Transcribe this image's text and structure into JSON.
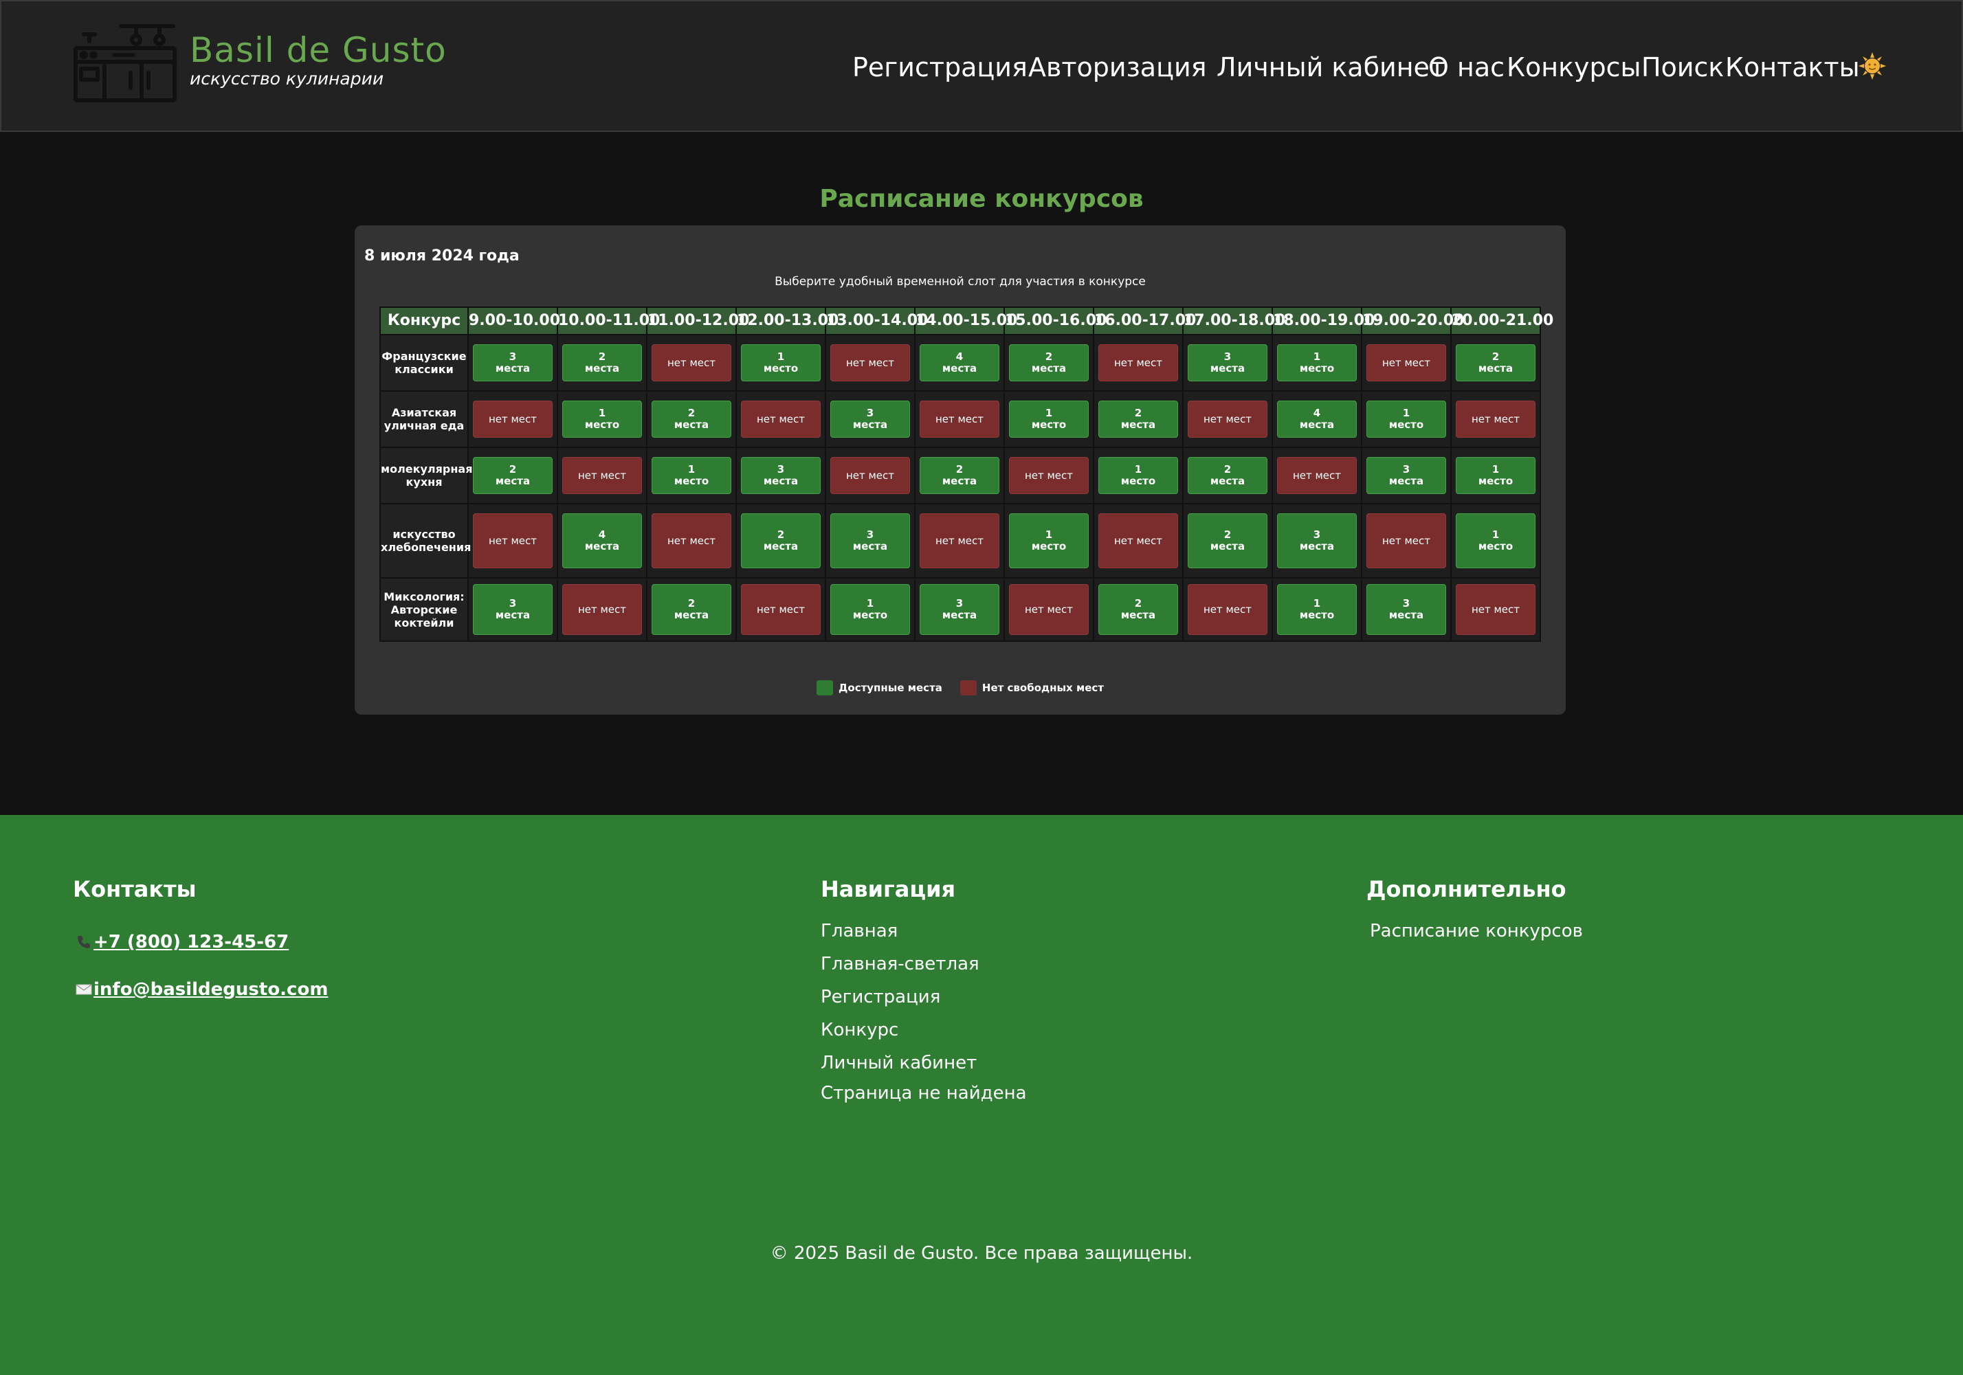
{
  "brand": {
    "name": "Basil de Gusto",
    "tagline": "искусство кулинарии"
  },
  "nav": [
    {
      "label": "Регистрация"
    },
    {
      "label": "Авторизация"
    },
    {
      "label": "Личный кабинет"
    },
    {
      "label": "О нас"
    },
    {
      "label": "Конкурсы"
    },
    {
      "label": "Поиск"
    },
    {
      "label": "Контакты"
    }
  ],
  "theme_toggle_icon": "sun-icon",
  "page_title": "Расписание конкурсов",
  "schedule": {
    "date": "8 июля 2024 года",
    "subtitle": "Выберите удобный временной слот для участия в конкурсе",
    "first_col_label": "Конкурс",
    "time_slots": [
      "9.00-10.00",
      "10.00-11.00",
      "11.00-12.00",
      "12.00-13.00",
      "13.00-14.00",
      "14.00-15.00",
      "15.00-16.00",
      "16.00-17.00",
      "17.00-18.00",
      "18.00-19.00",
      "19.00-20.00",
      "20.00-21.00"
    ],
    "rows": [
      {
        "name": "Французские классики",
        "slots": [
          {
            "avail": true,
            "count": "3",
            "word": "места"
          },
          {
            "avail": true,
            "count": "2",
            "word": "места"
          },
          {
            "avail": false,
            "text": "нет мест"
          },
          {
            "avail": true,
            "count": "1",
            "word": "место"
          },
          {
            "avail": false,
            "text": "нет мест"
          },
          {
            "avail": true,
            "count": "4",
            "word": "места"
          },
          {
            "avail": true,
            "count": "2",
            "word": "места"
          },
          {
            "avail": false,
            "text": "нет мест"
          },
          {
            "avail": true,
            "count": "3",
            "word": "места"
          },
          {
            "avail": true,
            "count": "1",
            "word": "место"
          },
          {
            "avail": false,
            "text": "нет мест"
          },
          {
            "avail": true,
            "count": "2",
            "word": "места"
          }
        ]
      },
      {
        "name": "Азиатская уличная еда",
        "slots": [
          {
            "avail": false,
            "text": "нет мест"
          },
          {
            "avail": true,
            "count": "1",
            "word": "место"
          },
          {
            "avail": true,
            "count": "2",
            "word": "места"
          },
          {
            "avail": false,
            "text": "нет мест"
          },
          {
            "avail": true,
            "count": "3",
            "word": "места"
          },
          {
            "avail": false,
            "text": "нет мест"
          },
          {
            "avail": true,
            "count": "1",
            "word": "место"
          },
          {
            "avail": true,
            "count": "2",
            "word": "места"
          },
          {
            "avail": false,
            "text": "нет мест"
          },
          {
            "avail": true,
            "count": "4",
            "word": "места"
          },
          {
            "avail": true,
            "count": "1",
            "word": "место"
          },
          {
            "avail": false,
            "text": "нет мест"
          }
        ]
      },
      {
        "name": "молекулярная кухня",
        "slots": [
          {
            "avail": true,
            "count": "2",
            "word": "места"
          },
          {
            "avail": false,
            "text": "нет мест"
          },
          {
            "avail": true,
            "count": "1",
            "word": "место"
          },
          {
            "avail": true,
            "count": "3",
            "word": "места"
          },
          {
            "avail": false,
            "text": "нет мест"
          },
          {
            "avail": true,
            "count": "2",
            "word": "места"
          },
          {
            "avail": false,
            "text": "нет мест"
          },
          {
            "avail": true,
            "count": "1",
            "word": "место"
          },
          {
            "avail": true,
            "count": "2",
            "word": "места"
          },
          {
            "avail": false,
            "text": "нет мест"
          },
          {
            "avail": true,
            "count": "3",
            "word": "места"
          },
          {
            "avail": true,
            "count": "1",
            "word": "место"
          }
        ]
      },
      {
        "name": "искусство хлебопечения",
        "slots": [
          {
            "avail": false,
            "text": "нет мест"
          },
          {
            "avail": true,
            "count": "4",
            "word": "места"
          },
          {
            "avail": false,
            "text": "нет мест"
          },
          {
            "avail": true,
            "count": "2",
            "word": "места"
          },
          {
            "avail": true,
            "count": "3",
            "word": "места"
          },
          {
            "avail": false,
            "text": "нет мест"
          },
          {
            "avail": true,
            "count": "1",
            "word": "место"
          },
          {
            "avail": false,
            "text": "нет мест"
          },
          {
            "avail": true,
            "count": "2",
            "word": "места"
          },
          {
            "avail": true,
            "count": "3",
            "word": "места"
          },
          {
            "avail": false,
            "text": "нет мест"
          },
          {
            "avail": true,
            "count": "1",
            "word": "место"
          }
        ]
      },
      {
        "name": "Миксология: Авторские коктейли",
        "slots": [
          {
            "avail": true,
            "count": "3",
            "word": "места"
          },
          {
            "avail": false,
            "text": "нет мест"
          },
          {
            "avail": true,
            "count": "2",
            "word": "места"
          },
          {
            "avail": false,
            "text": "нет мест"
          },
          {
            "avail": true,
            "count": "1",
            "word": "место"
          },
          {
            "avail": true,
            "count": "3",
            "word": "места"
          },
          {
            "avail": false,
            "text": "нет мест"
          },
          {
            "avail": true,
            "count": "2",
            "word": "места"
          },
          {
            "avail": false,
            "text": "нет мест"
          },
          {
            "avail": true,
            "count": "1",
            "word": "место"
          },
          {
            "avail": true,
            "count": "3",
            "word": "места"
          },
          {
            "avail": false,
            "text": "нет мест"
          }
        ]
      }
    ],
    "legend": [
      {
        "label": "Доступные места",
        "color": "#2e7d32"
      },
      {
        "label": "Нет свободных мест",
        "color": "#7b2d2d"
      }
    ]
  },
  "footer": {
    "contacts": {
      "heading": "Контакты",
      "phone": "+7 (800) 123-45-67",
      "phone_icon": "phone-icon",
      "email": "info@basildegusto.com",
      "email_icon": "envelope-icon"
    },
    "navigation": {
      "heading": "Навигация",
      "links": [
        "Главная",
        "Главная-светлая",
        "Регистрация",
        "Конкурс",
        "Личный кабинет",
        "Страница не найдена"
      ]
    },
    "extra": {
      "heading": "Дополнительно",
      "links": [
        "Расписание конкурсов"
      ]
    },
    "copyright": "© 2025 Basil de Gusto. Все права защищены."
  },
  "colors": {
    "accent_green": "#6aa84f",
    "footer_green": "#2e7d32",
    "available": "#2e7d32",
    "unavailable": "#7b2d2d",
    "header_bg": "#222222",
    "page_bg": "#121212"
  }
}
